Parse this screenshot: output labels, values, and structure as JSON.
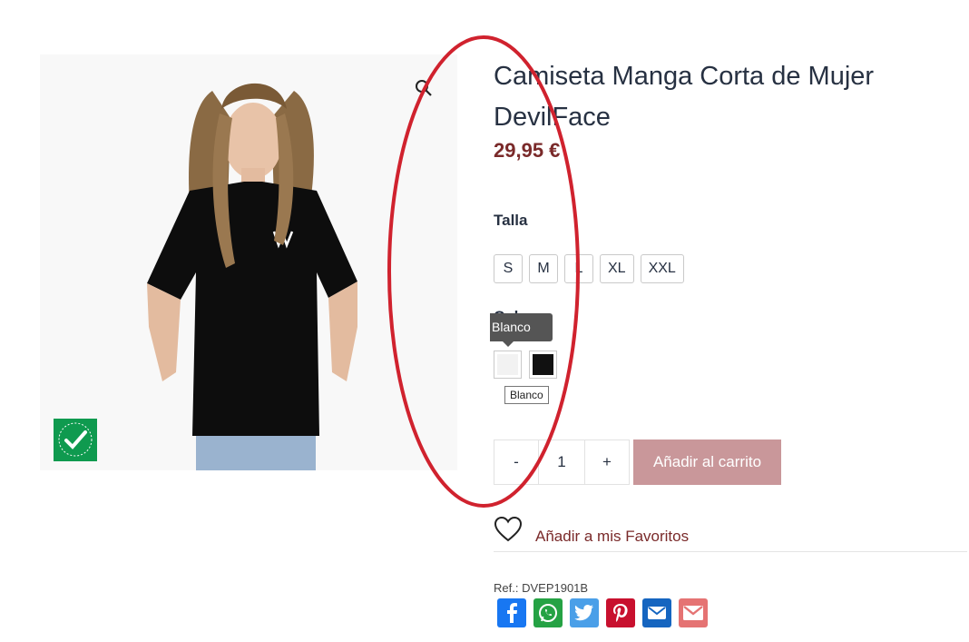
{
  "product": {
    "title": "Camiseta Manga Corta de Mujer DevilFace",
    "price": "29,95 €",
    "ref_label": "Ref.:",
    "ref_value": "DVEP1901B"
  },
  "size": {
    "label": "Talla",
    "options": [
      "S",
      "M",
      "L",
      "XL",
      "XXL"
    ]
  },
  "color": {
    "label": "Color",
    "tooltip": "Blanco",
    "hover_tip": "Blanco",
    "options": [
      {
        "name": "Blanco",
        "hex": "#f2f2f2"
      },
      {
        "name": "Negro",
        "hex": "#111111"
      }
    ]
  },
  "cart": {
    "minus": "-",
    "quantity": "1",
    "plus": "+",
    "add_label": "Añadir al carrito"
  },
  "favorites": {
    "label": "Añadir a mis Favoritos"
  },
  "share": [
    {
      "icon": "facebook-icon",
      "color": "#1877f2"
    },
    {
      "icon": "whatsapp-icon",
      "color": "#25a244"
    },
    {
      "icon": "twitter-icon",
      "color": "#4a9fe8"
    },
    {
      "icon": "pinterest-icon",
      "color": "#c8102e"
    },
    {
      "icon": "email-icon",
      "color": "#1565c0"
    },
    {
      "icon": "gmail-icon",
      "color": "#e57373"
    }
  ],
  "colors": {
    "accent": "#7a2a2a",
    "cart_button": "#c9979a",
    "annotation": "#d0222e"
  }
}
